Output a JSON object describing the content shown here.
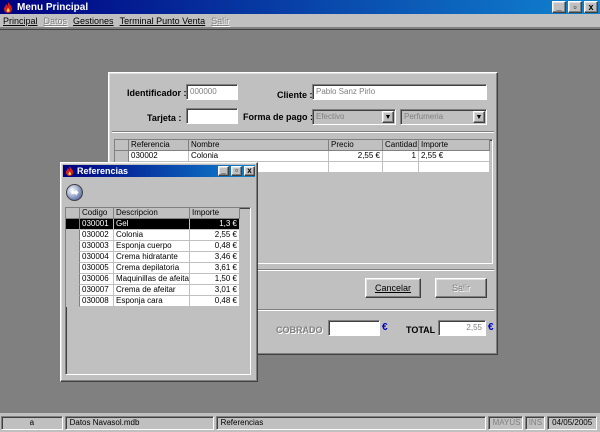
{
  "window": {
    "title": "Menu Principal",
    "min": "_",
    "max": "▫",
    "close": "x"
  },
  "menu": [
    {
      "label": "Principal",
      "enabled": true
    },
    {
      "label": "Datos",
      "enabled": false
    },
    {
      "label": "Gestiones",
      "enabled": true
    },
    {
      "label": "Terminal Punto Venta",
      "enabled": true
    },
    {
      "label": "Salir",
      "enabled": false
    }
  ],
  "sales": {
    "identificador_label": "Identificador :",
    "identificador_value": "000000",
    "cliente_label": "Cliente :",
    "cliente_value": "Pablo Sanz Pirlo",
    "tarjeta_label": "Tarjeta :",
    "tarjeta_value": "",
    "forma_pago_label": "Forma de pago :",
    "forma_pago_value": "Efectivo",
    "seccion_value": "Perfumeria",
    "grid_headers": [
      "Referencia",
      "Nombre",
      "Precio",
      "Cantidad",
      "Importe"
    ],
    "lines": [
      {
        "ref": "030002",
        "name": "Colonia",
        "price": "2,55 €",
        "qty": "1",
        "amount": "2,55 €"
      }
    ],
    "cancel_label": "Cancelar",
    "exit_label": "Salir",
    "cobrado_label": "COBRADO",
    "cobrado_value": "",
    "total_label": "TOTAL",
    "total_value": "2,55",
    "euro_symbol": "€"
  },
  "referencias": {
    "title": "Referencias",
    "headers": [
      "Codigo",
      "Descripcion",
      "Importe"
    ],
    "rows": [
      {
        "code": "030001",
        "desc": "Gel",
        "amount": "1,3 €",
        "selected": true
      },
      {
        "code": "030002",
        "desc": "Colonia",
        "amount": "2,55 €"
      },
      {
        "code": "030003",
        "desc": "Esponja cuerpo",
        "amount": "0,48 €"
      },
      {
        "code": "030004",
        "desc": "Crema hidratante",
        "amount": "3,46 €"
      },
      {
        "code": "030005",
        "desc": "Crema depilatoria",
        "amount": "3,61 €"
      },
      {
        "code": "030006",
        "desc": "Maquinillas de afeitar",
        "amount": "1,50 €"
      },
      {
        "code": "030007",
        "desc": "Crema de afeitar",
        "amount": "3,01 €"
      },
      {
        "code": "030008",
        "desc": "Esponja cara",
        "amount": "0,48 €"
      }
    ]
  },
  "status": {
    "p1": "a",
    "p2": "Datos Navasol.mdb",
    "p3": "Referencias",
    "caps": "MAYÚS",
    "ins": "INS",
    "date": "04/05/2005"
  },
  "colors": {
    "titlebar": "#000080",
    "desktop": "#808080",
    "face": "#c0c0c0",
    "euro": "#0000c0"
  }
}
